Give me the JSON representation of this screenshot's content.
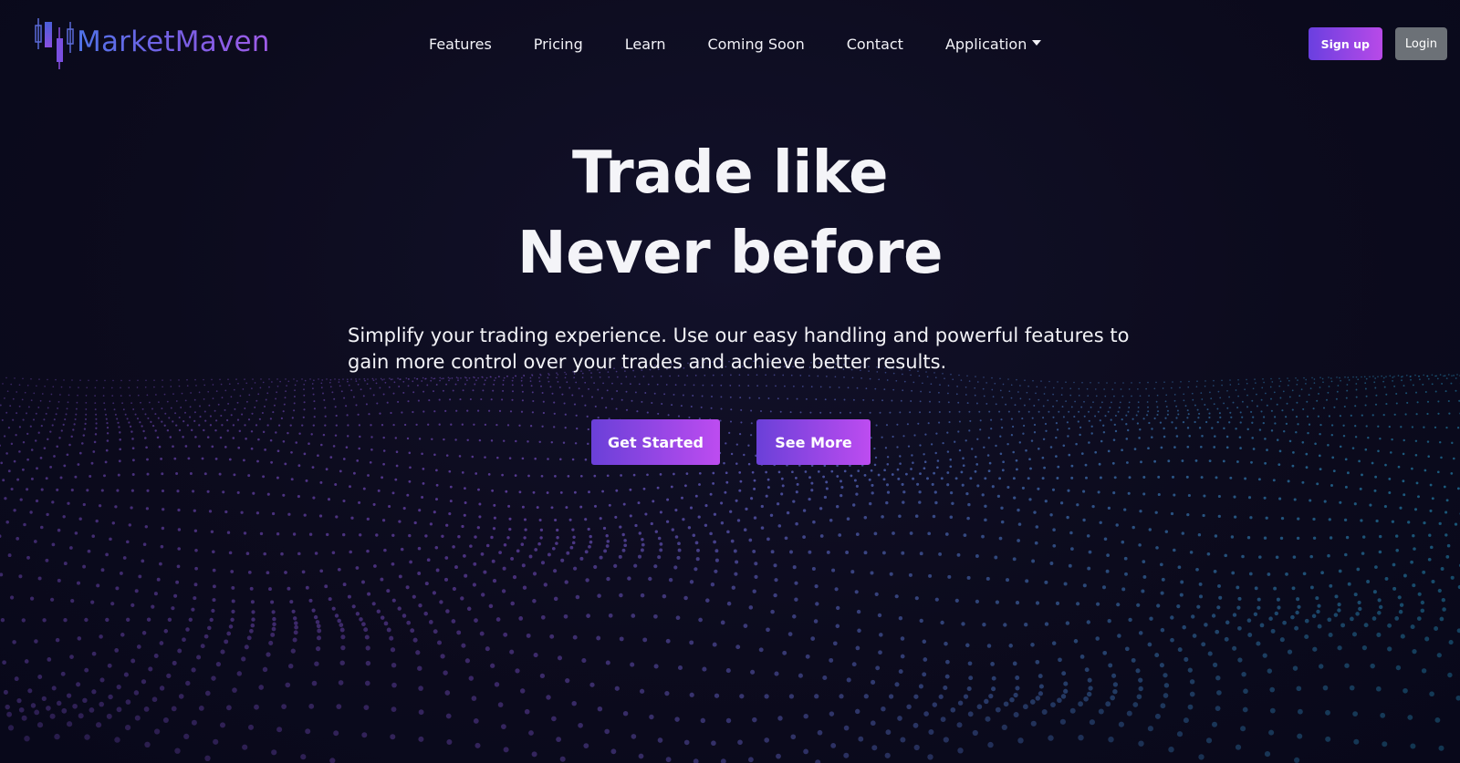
{
  "brand": {
    "name": "MarketMaven",
    "logo_icon": "candlestick-chart-icon"
  },
  "nav": {
    "links": [
      {
        "label": "Features"
      },
      {
        "label": "Pricing"
      },
      {
        "label": "Learn"
      },
      {
        "label": "Coming Soon"
      },
      {
        "label": "Contact"
      }
    ],
    "dropdown": {
      "label": "Application",
      "icon": "caret-down-icon"
    }
  },
  "auth": {
    "signup_label": "Sign up",
    "login_label": "Login"
  },
  "hero": {
    "title_line1": "Trade like",
    "title_line2": "Never before",
    "subtitle": "Simplify your trading experience. Use our easy handling and powerful features to gain more control over your trades and achieve better results.",
    "primary_button": "Get Started",
    "secondary_button": "See More"
  },
  "colors": {
    "background": "#0c0b1d",
    "accent_start": "#6a40d8",
    "accent_end": "#bd4cf0",
    "login_button": "#6c7177",
    "dot_purple": "#7a4fc8",
    "dot_cyan": "#2a9fd0"
  }
}
